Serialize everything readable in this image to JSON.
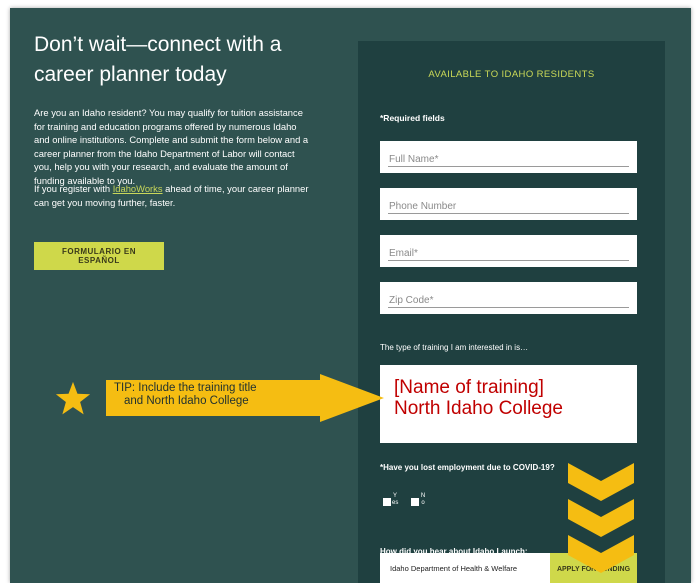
{
  "left": {
    "headline": "Don’t wait—connect with a career planner today",
    "paragraph1": "Are you an Idaho resident? You may qualify for tuition assistance for training and education programs offered by numerous Idaho and online institutions. Complete and submit the form below and a career planner from the Idaho Department of Labor will contact you, help you with your research, and evaluate the amount of funding available to you.",
    "paragraph2_before": "If you register with ",
    "paragraph2_link": "IdahoWorks",
    "paragraph2_after": " ahead of time, your career planner can get you moving further, faster.",
    "spanish_button": "FORMULARIO EN ESPAÑOL"
  },
  "form": {
    "title": "AVAILABLE TO IDAHO RESIDENTS",
    "required_note": "*Required fields",
    "full_name_placeholder": "Full Name*",
    "phone_placeholder": "Phone Number",
    "email_placeholder": "Email*",
    "zip_placeholder": "Zip Code*",
    "training_label": "The type of training I am interested in is…",
    "training_value": "[Name of training]\nNorth Idaho College",
    "covid_question": "*Have you lost employment due to COVID-19?",
    "yes_label": "Y es",
    "no_label": "N o",
    "hear_label": "How did you hear about Idaho Launch:",
    "hear_value": "Idaho Department of Health & Welfare",
    "apply_button": "APPLY FOR FUNDING"
  },
  "annotation": {
    "tip_line1": "TIP: Include the training title",
    "tip_line2": "and North Idaho College",
    "colors": {
      "star": "#f5bd12",
      "tip_arrow": "#f5bd12",
      "chevrons": "#f5bd12",
      "training_text": "#c00000"
    }
  },
  "colors": {
    "background": "#2f5250",
    "panel": "#1f4040",
    "accent": "#cfd84a"
  }
}
